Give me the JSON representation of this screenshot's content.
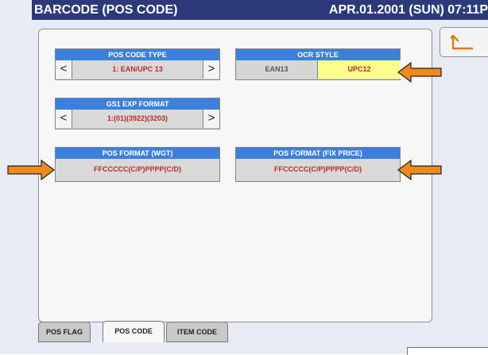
{
  "title": {
    "text": "BARCODE (POS CODE)",
    "datetime": "APR.01.2001 (SUN) 07:11P"
  },
  "fields": {
    "pos_code_type": {
      "header": "POS CODE TYPE",
      "value": "1: EAN/UPC 13"
    },
    "ocr_style": {
      "header": "OCR STYLE",
      "options": [
        "EAN13",
        "UPC12"
      ],
      "selected": "UPC12"
    },
    "gs1_exp_format": {
      "header": "GS1 EXP FORMAT",
      "value": "1:(01)(3922)(3203)"
    },
    "pos_format_wgt": {
      "header": "POS FORMAT (WGT)",
      "value": "FFCCCCC(C/P)PPPP(C/D)"
    },
    "pos_format_fix_price": {
      "header": "POS FORMAT (FIX PRICE)",
      "value": "FFCCCCC(C/P)PPPP(C/D)"
    }
  },
  "arrows": {
    "left": "<",
    "right": ">"
  },
  "tabs": [
    {
      "label": "POS FLAG",
      "active": false
    },
    {
      "label": "POS CODE",
      "active": true
    },
    {
      "label": "ITEM CODE",
      "active": false
    }
  ],
  "icons": {
    "back": "return-arrow-icon",
    "pointer": "orange-arrow-icon"
  },
  "colors": {
    "title_bar": "#2c3a7c",
    "field_header": "#3b80dc",
    "value_text": "#b82a2a",
    "selected_option": "#fdfd8c",
    "callout_arrow": "#f08a1c",
    "back_icon": "#e07a10"
  }
}
